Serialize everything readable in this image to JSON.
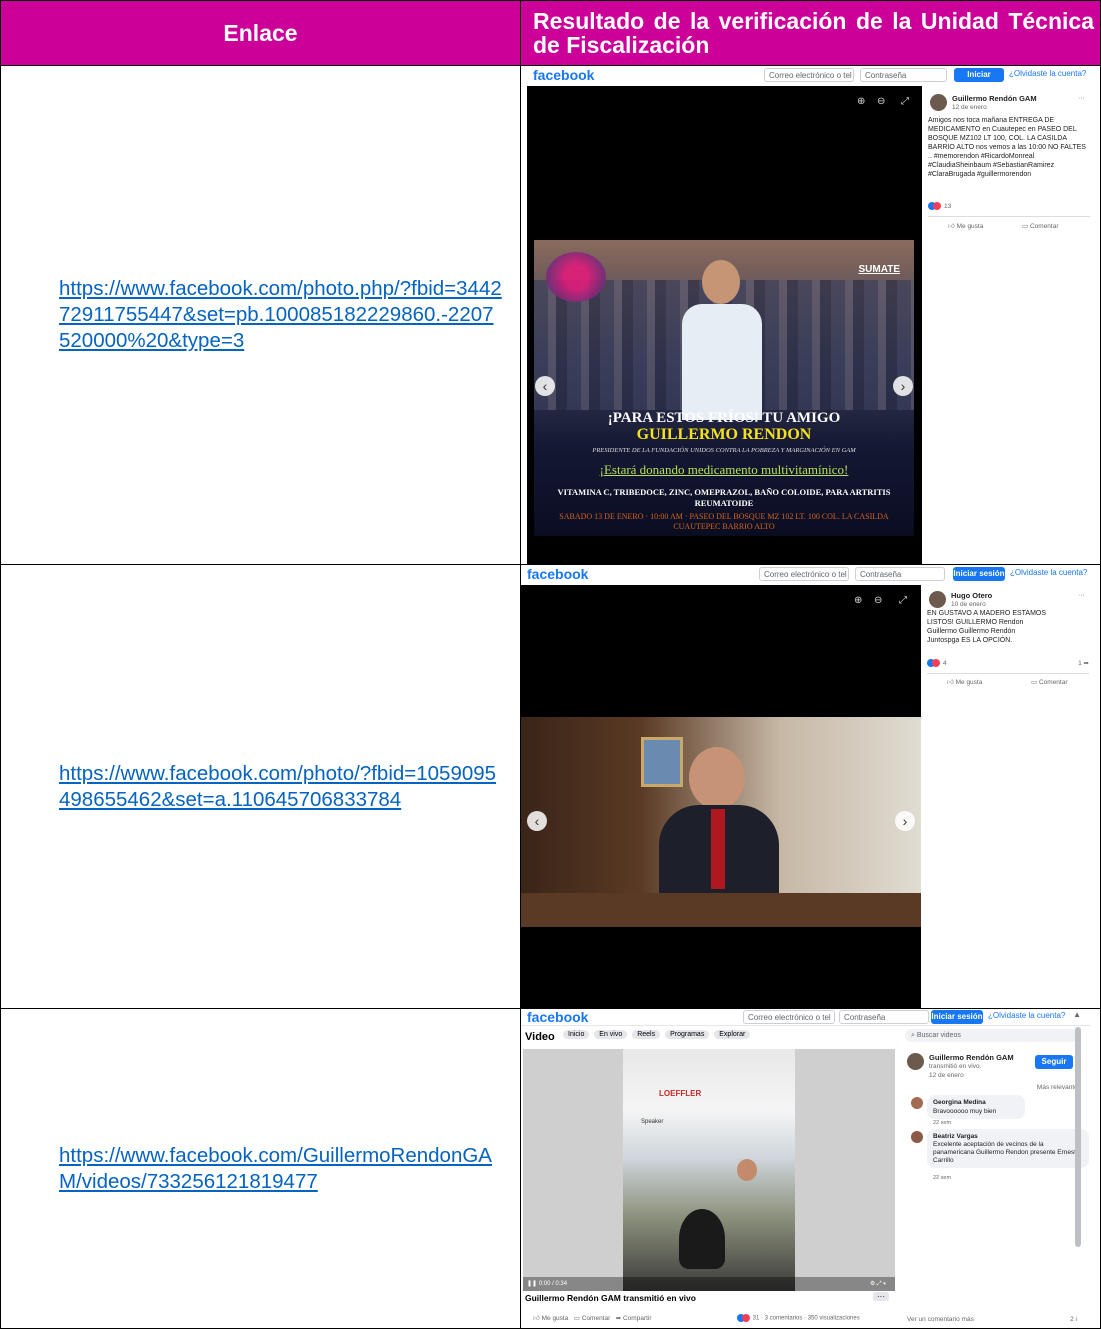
{
  "table": {
    "col1_header": "Enlace",
    "col2_header": "Resultado de la verificación de la Unidad Técnica de Fiscalización"
  },
  "rows": [
    {
      "link": "https://www.facebook.com/photo.php/?fbid=344272911755447&set=pb.100085182229860.-2207520000%20&type=3",
      "shot": {
        "logo": "facebook",
        "email_placeholder": "Correo electrónico o tel",
        "password_placeholder": "Contraseña",
        "login_label": "Iniciar sesión",
        "forgot_label": "¿Olvidaste la cuenta?",
        "author": "Guillermo Rendón GAM",
        "date": "12 de enero",
        "post_text": "Amigos nos toca mañana ENTREGA DE MEDICAMENTO en Cuautepec en PASEO DEL BOSQUE MZ102 LT 100, COL. LA CASILDA BARRIO ALTO nos vemos a las 10:00 NO FALTES .. #memorendon #RicardoMonreal #ClaudiaSheinbaum #SebastianRamirez #ClaraBrugada #guillermorendon",
        "reactions": "13",
        "like_label": "Me gusta",
        "comment_label": "Comentar",
        "flyer": {
          "brand": "SUMATE",
          "headline1": "¡PARA ESTOS FRÍOS! TU AMIGO",
          "headline2": "GUILLERMO RENDON",
          "role": "PRESIDENTE DE LA FUNDACIÓN UNIDOS CONTRA LA POBREZA Y MARGINACIÓN EN GAM",
          "donation": "¡Estará donando medicamento multivitamínico!",
          "meds": "VITAMINA C, TRIBEDOCE, ZINC, OMEPRAZOL, BAÑO COLOIDE, PARA ARTRITIS REUMATOIDE",
          "event": "SABADO 13 DE ENERO · 10:00 AM · PASEO DEL BOSQUE MZ 102 LT. 100 COL. LA CASILDA CUAUTEPEC BARRIO ALTO"
        }
      }
    },
    {
      "link": "https://www.facebook.com/photo/?fbid=1059095498655462&set=a.110645706833784",
      "shot": {
        "logo": "facebook",
        "email_placeholder": "Correo electrónico o tel",
        "password_placeholder": "Contraseña",
        "login_label": "Iniciar sesión",
        "forgot_label": "¿Olvidaste la cuenta?",
        "author": "Hugo Otero",
        "date": "10 de enero",
        "post_text": "EN GUSTAVO A MADERO ESTAMOS LISTOS! GUILLERMO Rendon Guillermo Guillermo Rendón Juntospga ES LA OPCIÓN.",
        "reactions": "4",
        "shares": "1",
        "like_label": "Me gusta",
        "comment_label": "Comentar"
      }
    },
    {
      "link": "https://www.facebook.com/GuillermoRendonGAM/videos/733256121819477",
      "shot": {
        "logo": "facebook",
        "email_placeholder": "Correo electrónico o tel",
        "password_placeholder": "Contraseña",
        "login_label": "Iniciar sesión",
        "forgot_label": "¿Olvidaste la cuenta?",
        "section": "Video",
        "tabs": [
          "Inicio",
          "En vivo",
          "Reels",
          "Programas",
          "Explorar"
        ],
        "search_placeholder": "Buscar videos",
        "author": "Guillermo Rendón GAM",
        "live_text": "transmitió en vivo.",
        "date": "12 de enero",
        "follow_label": "Seguir",
        "sort_label": "Más relevantes",
        "comments": [
          {
            "name": "Georgina Medina",
            "text": "Bravoooooo muy bien",
            "time": "22 sem"
          },
          {
            "name": "Beatriz Vargas",
            "text": "Excelente aceptación de vecinos de la panamericana Guillermo Rendon presente Ernesto Carrillo",
            "time": "22 sem"
          }
        ],
        "video_title": "Guillermo Rendón GAM transmitió en vivo",
        "player_time": "0:00 / 0:34",
        "like_label": "Me gusta",
        "comment_label": "Comentar",
        "share_label": "Compartir",
        "stats": "31 · 3 comentarios · 350 visualizaciones",
        "more_comments": "Ver un comentario más",
        "page_count": "2 i",
        "tent_text": "LOEFFLER",
        "speaker_text": "Speaker"
      }
    }
  ],
  "colors": {
    "header_bg": "#cc0099",
    "link": "#0563c1",
    "fb_blue": "#1877f2"
  }
}
